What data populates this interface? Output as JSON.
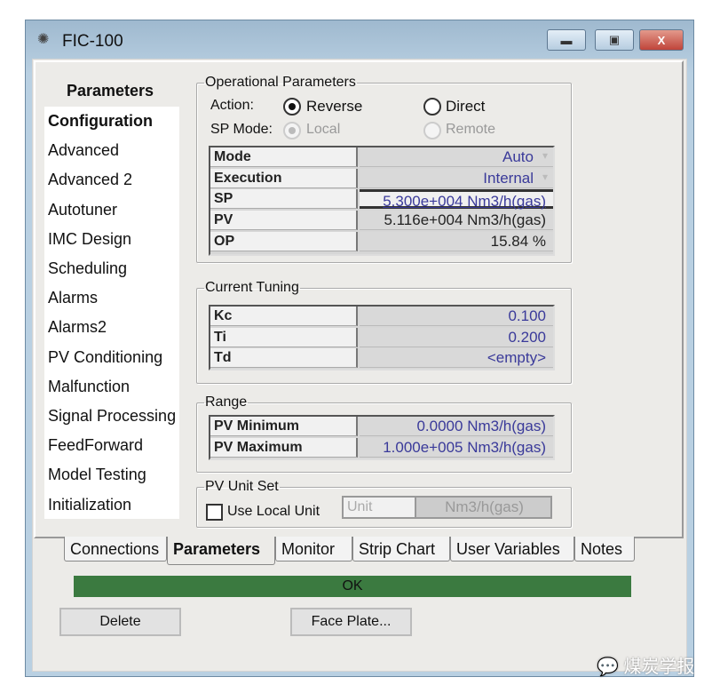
{
  "window": {
    "title": "FIC-100",
    "icon": "gear-icon",
    "controls": [
      "minimize",
      "maximize",
      "close"
    ]
  },
  "sidebar": {
    "header": "Parameters",
    "items": [
      "Configuration",
      "Advanced",
      "Advanced 2",
      "Autotuner",
      "IMC Design",
      "Scheduling",
      "Alarms",
      "Alarms2",
      "PV Conditioning",
      "Malfunction",
      "Signal Processing",
      "FeedForward",
      "Model Testing",
      "Initialization"
    ],
    "selected": "Configuration"
  },
  "operational": {
    "legend": "Operational Parameters",
    "action_label": "Action:",
    "reverse": "Reverse",
    "direct": "Direct",
    "action_selected": "Reverse",
    "sp_mode_label": "SP Mode:",
    "local": "Local",
    "remote": "Remote",
    "sp_mode_selected": "Local",
    "rows": [
      {
        "label": "Mode",
        "value": "Auto"
      },
      {
        "label": "Execution",
        "value": "Internal"
      },
      {
        "label": "SP",
        "value": "5.300e+004 Nm3/h(gas)"
      },
      {
        "label": "PV",
        "value": "5.116e+004 Nm3/h(gas)"
      },
      {
        "label": "OP",
        "value": "15.84 %"
      }
    ]
  },
  "tuning": {
    "legend": "Current Tuning",
    "rows": [
      {
        "label": "Kc",
        "value": "0.100"
      },
      {
        "label": "Ti",
        "value": "0.200"
      },
      {
        "label": "Td",
        "value": "<empty>"
      }
    ]
  },
  "range": {
    "legend": "Range",
    "rows": [
      {
        "label": "PV Minimum",
        "value": "0.0000 Nm3/h(gas)"
      },
      {
        "label": "PV Maximum",
        "value": "1.000e+005 Nm3/h(gas)"
      }
    ]
  },
  "unitset": {
    "legend": "PV Unit Set",
    "checkbox": "Use Local Unit",
    "checked": false,
    "unit_label": "Unit",
    "unit_value": "Nm3/h(gas)"
  },
  "tabs": [
    "Connections",
    "Parameters",
    "Monitor",
    "Strip Chart",
    "User Variables",
    "Notes"
  ],
  "active_tab": "Parameters",
  "status": {
    "text": "OK",
    "color": "#3b7a40"
  },
  "buttons": {
    "delete": "Delete",
    "faceplate": "Face Plate..."
  },
  "watermark": "煤炭学报"
}
